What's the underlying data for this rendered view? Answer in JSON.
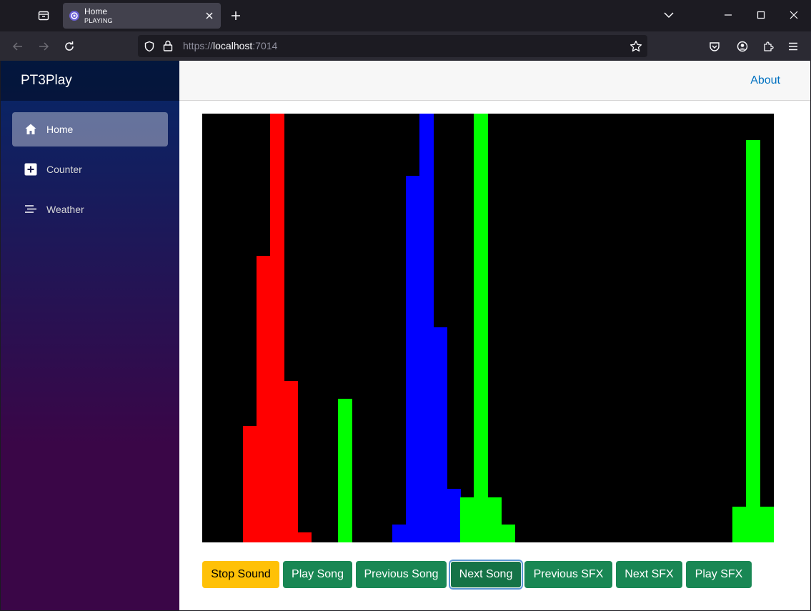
{
  "browser": {
    "tab": {
      "title": "Home",
      "subtitle": "PLAYING"
    },
    "url": {
      "scheme": "https://",
      "host": "localhost",
      "port": ":7014"
    }
  },
  "sidebar": {
    "brand": "PT3Play",
    "items": [
      {
        "label": "Home",
        "icon": "home-icon",
        "active": true
      },
      {
        "label": "Counter",
        "icon": "plus-icon",
        "active": false
      },
      {
        "label": "Weather",
        "icon": "list-icon",
        "active": false
      }
    ]
  },
  "header": {
    "about_label": "About"
  },
  "visualizer": {
    "colors": {
      "red": "#ff0000",
      "green": "#00ff00",
      "blue": "#0000ff",
      "background": "#000000"
    }
  },
  "controls": {
    "stop_sound": "Stop Sound",
    "play_song": "Play Song",
    "previous_song": "Previous Song",
    "next_song": "Next Song",
    "previous_sfx": "Previous SFX",
    "next_sfx": "Next SFX",
    "play_sfx": "Play SFX"
  }
}
